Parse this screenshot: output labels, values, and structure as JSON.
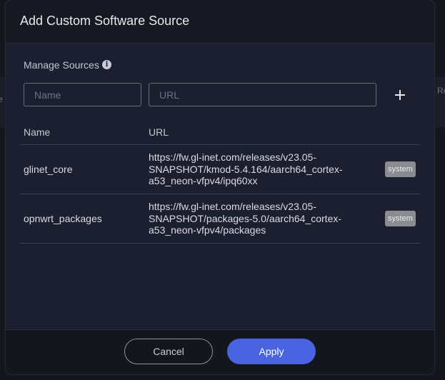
{
  "background": {
    "left_edge_text": "e",
    "right_edge_text": "Re"
  },
  "dialog": {
    "title": "Add Custom Software Source",
    "section_label": "Manage Sources",
    "info_icon": "info-icon",
    "inputs": {
      "name_placeholder": "Name",
      "name_value": "",
      "url_placeholder": "URL",
      "url_value": ""
    },
    "add_icon": "plus-icon",
    "table": {
      "columns": [
        "Name",
        "URL"
      ],
      "rows": [
        {
          "name": "glinet_core",
          "url": "https://fw.gl-inet.com/releases/v23.05-SNAPSHOT/kmod-5.4.164/aarch64_cortex-a53_neon-vfpv4/ipq60xx",
          "badge": "system"
        },
        {
          "name": "opnwrt_packages",
          "url": "https://fw.gl-inet.com/releases/v23.05-SNAPSHOT/packages-5.0/aarch64_cortex-a53_neon-vfpv4/packages",
          "badge": "system"
        }
      ]
    },
    "footer": {
      "cancel_label": "Cancel",
      "apply_label": "Apply"
    }
  },
  "colors": {
    "accent": "#4a63e0",
    "badge": "#8a8c92",
    "dialog_body": "#1b1f30"
  }
}
